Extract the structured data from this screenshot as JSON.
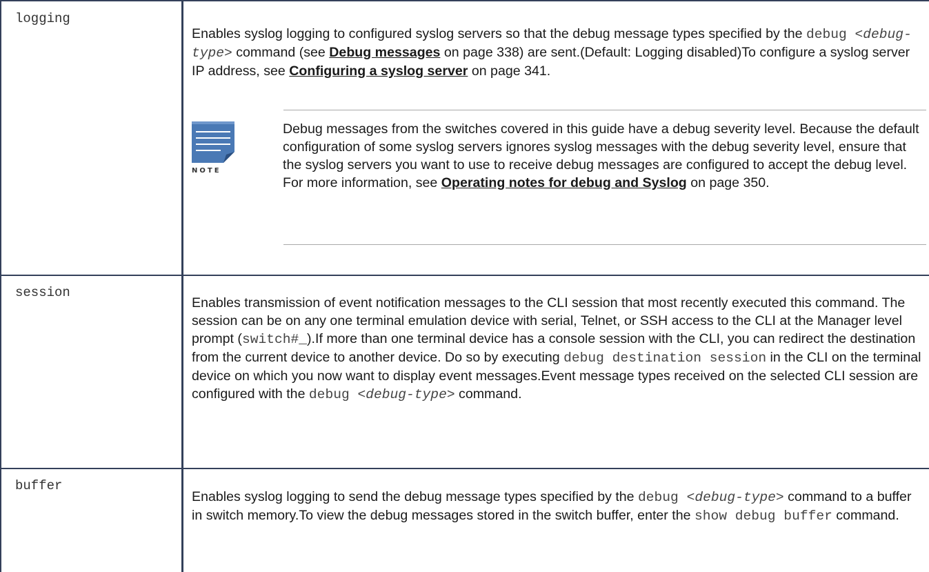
{
  "rows": [
    {
      "param": "logging",
      "desc": [
        {
          "t": "text",
          "v": "Enables syslog logging to configured syslog servers so that the debug message types specified by the "
        },
        {
          "t": "code",
          "v": "debug "
        },
        {
          "t": "codei",
          "v": "<debug-type>"
        },
        {
          "t": "text",
          "v": "  command (see "
        },
        {
          "t": "link",
          "v": "Debug messages"
        },
        {
          "t": "text",
          "v": " on page 338) are sent.(Default: Logging disabled)To configure a syslog server IP address, see "
        },
        {
          "t": "link",
          "v": "Configuring a syslog server"
        },
        {
          "t": "text",
          "v": " on page 341."
        }
      ],
      "note": {
        "icon_label": "NOTE",
        "content": [
          {
            "t": "text",
            "v": "Debug messages from the switches covered in this guide have a debug severity level. Because the default configuration of some syslog servers ignores syslog messages with the debug severity level, ensure that the syslog servers you want to use to receive debug messages are configured to accept the debug level. For more information, see "
          },
          {
            "t": "link",
            "v": "Operating notes for debug and Syslog"
          },
          {
            "t": "text",
            "v": " on page 350."
          }
        ]
      }
    },
    {
      "param": "session",
      "desc": [
        {
          "t": "text",
          "v": "Enables transmission of event notification messages to the CLI session that most recently executed this command. The session can be on any one terminal emulation device with serial, Telnet, or SSH access to the CLI at the Manager level prompt ("
        },
        {
          "t": "code",
          "v": "switch#_"
        },
        {
          "t": "text",
          "v": ").If more than one terminal device has a console session with the CLI, you can redirect the destination from the current device to another device. Do so by executing "
        },
        {
          "t": "code",
          "v": "debug destination session"
        },
        {
          "t": "text",
          "v": " in the CLI on the terminal device on which you now want to display event messages.Event message types received on the selected CLI session are configured with the "
        },
        {
          "t": "code",
          "v": "debug "
        },
        {
          "t": "codei",
          "v": "<debug-type>"
        },
        {
          "t": "text",
          "v": "  command."
        }
      ]
    },
    {
      "param": "buffer",
      "desc": [
        {
          "t": "text",
          "v": "Enables syslog logging to send the debug message types specified by the "
        },
        {
          "t": "code",
          "v": "debug "
        },
        {
          "t": "codei",
          "v": "<debug-type>"
        },
        {
          "t": "text",
          "v": "  command to a buffer in switch memory.To view the debug messages stored in the switch buffer, enter the "
        },
        {
          "t": "code",
          "v": "show debug buffer"
        },
        {
          "t": "text",
          "v": " command."
        }
      ]
    }
  ],
  "colors": {
    "border": "#33405a",
    "note_icon": "#4a79b5",
    "rule": "#a9a9a9"
  }
}
